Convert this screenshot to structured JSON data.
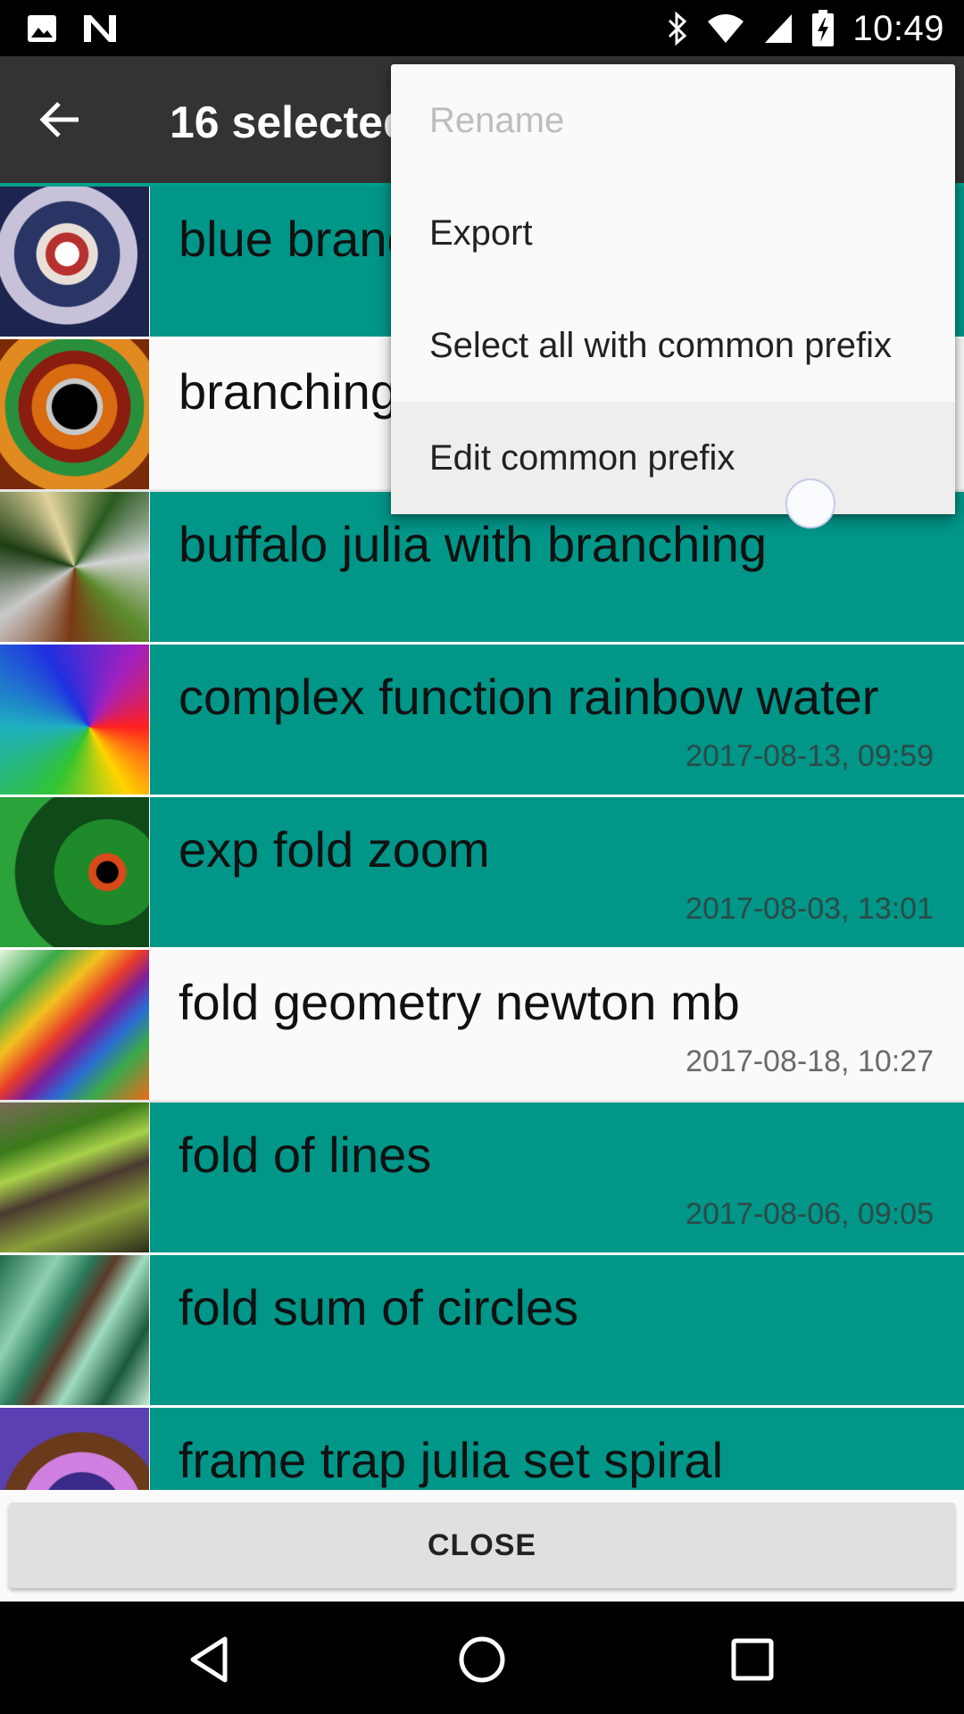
{
  "status_bar": {
    "time": "10:49",
    "icons_left": [
      "image-icon",
      "n-icon"
    ],
    "icons_right": [
      "bluetooth-icon",
      "wifi-icon",
      "signal-icon",
      "battery-charging-icon"
    ]
  },
  "app_bar": {
    "title": "16 selected",
    "back_icon": "arrow-back-icon"
  },
  "list": {
    "items": [
      {
        "title": "blue branching",
        "date": "",
        "selected": true
      },
      {
        "title": "branching",
        "date": "",
        "selected": false
      },
      {
        "title": "buffalo julia with branching",
        "date": "",
        "selected": true
      },
      {
        "title": "complex function rainbow water",
        "date": "2017-08-13, 09:59",
        "selected": true
      },
      {
        "title": "exp fold zoom",
        "date": "2017-08-03, 13:01",
        "selected": true
      },
      {
        "title": "fold geometry newton mb",
        "date": "2017-08-18, 10:27",
        "selected": false
      },
      {
        "title": "fold of lines",
        "date": "2017-08-06, 09:05",
        "selected": true
      },
      {
        "title": "fold sum of circles",
        "date": "",
        "selected": true
      },
      {
        "title": "frame trap julia set spiral",
        "date": "",
        "selected": true
      }
    ]
  },
  "menu": {
    "items": [
      {
        "label": "Rename",
        "disabled": true
      },
      {
        "label": "Export",
        "disabled": false
      },
      {
        "label": "Select all with common prefix",
        "disabled": false
      },
      {
        "label": "Edit common prefix",
        "disabled": false
      }
    ]
  },
  "close_button": {
    "label": "CLOSE"
  },
  "colors": {
    "selected_row": "#009688",
    "app_bar": "#333333",
    "accent": "#00a08a"
  }
}
